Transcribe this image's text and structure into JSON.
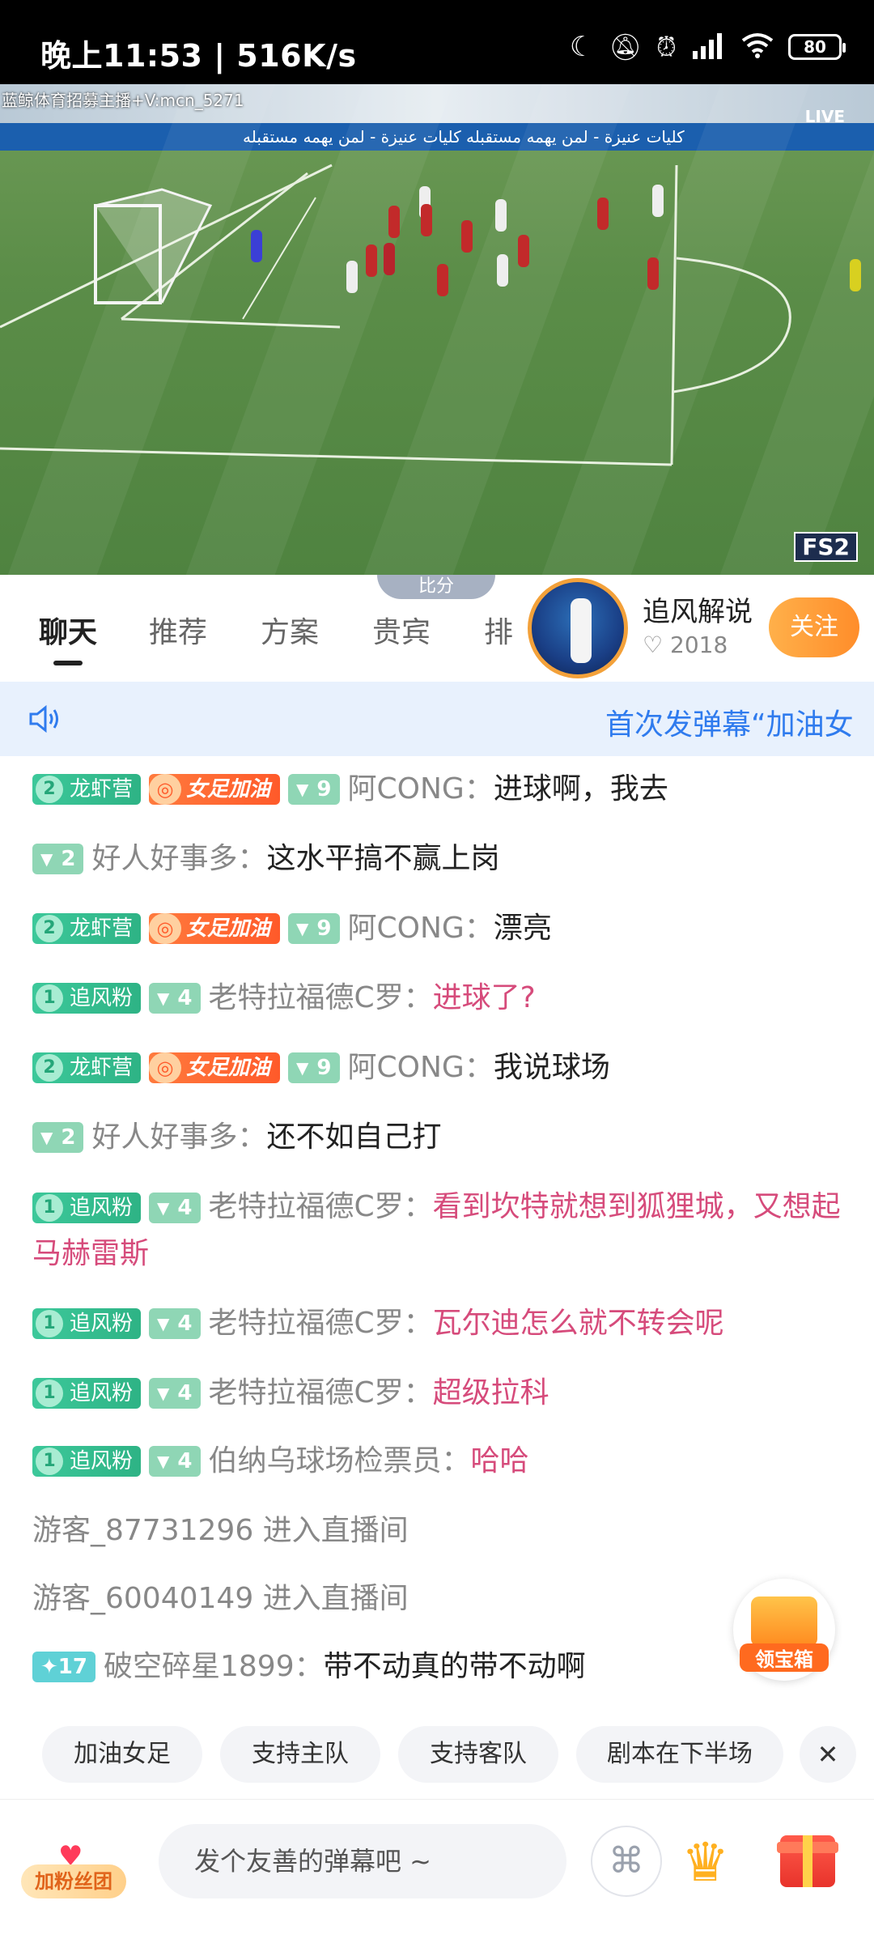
{
  "status_bar": {
    "time": "晚上11:53 | 516K/s",
    "battery": "80"
  },
  "video": {
    "watermark": "蓝鲸体育招募主播+V:mcn_5271",
    "live_label": "LIVE",
    "channel": "FS2",
    "ad_text": "كليات عنيزة - لمن يهمه مستقبله   كليات عنيزة - لمن يهمه مستقبله"
  },
  "tabs": {
    "score_label": "比分",
    "items": [
      "聊天",
      "推荐",
      "方案",
      "贵宾",
      "排"
    ]
  },
  "anchor": {
    "name": "追风解说",
    "fans": "2018",
    "follow_label": "关注"
  },
  "notice": {
    "text": "首次发弹幕“加油女"
  },
  "chat": [
    {
      "badges": [
        {
          "type": "fan",
          "lv": "2",
          "name": "龙虾营"
        },
        {
          "type": "women",
          "name": "女足加油"
        },
        {
          "type": "level",
          "lv": "9"
        }
      ],
      "user": "阿CONG",
      "sep": "：",
      "msg": "进球啊，我去",
      "pink": false
    },
    {
      "badges": [
        {
          "type": "level",
          "lv": "2"
        }
      ],
      "user": "好人好事多",
      "sep": "：",
      "msg": "这水平搞不赢上岗",
      "pink": false
    },
    {
      "badges": [
        {
          "type": "fan",
          "lv": "2",
          "name": "龙虾营"
        },
        {
          "type": "women",
          "name": "女足加油"
        },
        {
          "type": "level",
          "lv": "9"
        }
      ],
      "user": "阿CONG",
      "sep": "：",
      "msg": "漂亮",
      "pink": false
    },
    {
      "badges": [
        {
          "type": "fan",
          "lv": "1",
          "name": "追风粉"
        },
        {
          "type": "level",
          "lv": "4"
        }
      ],
      "user": "老特拉福德C罗",
      "sep": "：",
      "msg": "进球了?",
      "pink": true
    },
    {
      "badges": [
        {
          "type": "fan",
          "lv": "2",
          "name": "龙虾营"
        },
        {
          "type": "women",
          "name": "女足加油"
        },
        {
          "type": "level",
          "lv": "9"
        }
      ],
      "user": "阿CONG",
      "sep": "：",
      "msg": "我说球场",
      "pink": false
    },
    {
      "badges": [
        {
          "type": "level",
          "lv": "2"
        }
      ],
      "user": "好人好事多",
      "sep": "：",
      "msg": "还不如自己打",
      "pink": false
    },
    {
      "badges": [
        {
          "type": "fan",
          "lv": "1",
          "name": "追风粉"
        },
        {
          "type": "level",
          "lv": "4"
        }
      ],
      "user": "老特拉福德C罗",
      "sep": "：",
      "msg": "看到坎特就想到狐狸城，又想起马赫雷斯",
      "pink": true
    },
    {
      "badges": [
        {
          "type": "fan",
          "lv": "1",
          "name": "追风粉"
        },
        {
          "type": "level",
          "lv": "4"
        }
      ],
      "user": "老特拉福德C罗",
      "sep": "：",
      "msg": "瓦尔迪怎么就不转会呢",
      "pink": true
    },
    {
      "badges": [
        {
          "type": "fan",
          "lv": "1",
          "name": "追风粉"
        },
        {
          "type": "level",
          "lv": "4"
        }
      ],
      "user": "老特拉福德C罗",
      "sep": "：",
      "msg": "超级拉科",
      "pink": true
    },
    {
      "badges": [
        {
          "type": "fan",
          "lv": "1",
          "name": "追风粉"
        },
        {
          "type": "level",
          "lv": "4"
        }
      ],
      "user": "伯纳乌球场检票员",
      "sep": "：",
      "msg": "哈哈",
      "pink": true
    },
    {
      "system": "游客_87731296 进入直播间"
    },
    {
      "system": "游客_60040149 进入直播间"
    },
    {
      "badges": [
        {
          "type": "star",
          "lv": "17"
        }
      ],
      "user": "破空碎星1899",
      "sep": "：",
      "msg": "带不动真的带不动啊",
      "pink": false
    }
  ],
  "treasure": {
    "label": "领宝箱"
  },
  "quick_replies": [
    "加油女足",
    "支持主队",
    "支持客队",
    "剧本在下半场"
  ],
  "bottom": {
    "fan_club_label": "加粉丝团",
    "input_placeholder": "发个友善的弹幕吧 ~"
  },
  "colors": {
    "accent_blue": "#2f7bee",
    "follow_orange": "#ff8d2a",
    "pink_msg": "#d64b7b",
    "fan_green": "#2eb385"
  }
}
